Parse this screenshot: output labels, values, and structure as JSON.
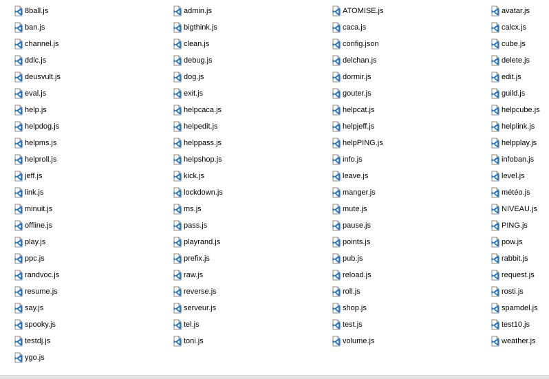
{
  "file_icon": "vscode-js-file-icon",
  "colors": {
    "icon_blue": "#1f74c9",
    "background": "#ffffff",
    "status_strip": "#e4e4e4"
  },
  "columns": [
    [
      "8ball.js",
      "ban.js",
      "channel.js",
      "ddlc.js",
      "deusvult.js",
      "eval.js",
      "help.js",
      "helpdog.js",
      "helpms.js",
      "helproll.js",
      "jeff.js",
      "link.js",
      "minuit.js",
      "offline.js",
      "play.js",
      "ppc.js",
      "randvoc.js",
      "resume.js",
      "say.js",
      "spooky.js",
      "testdj.js",
      "ygo.js"
    ],
    [
      "admin.js",
      "bigthink.js",
      "clean.js",
      "debug.js",
      "dog.js",
      "exit.js",
      "helpcaca.js",
      "helpedit.js",
      "helppass.js",
      "helpshop.js",
      "kick.js",
      "lockdown.js",
      "ms.js",
      "pass.js",
      "playrand.js",
      "prefix.js",
      "raw.js",
      "reverse.js",
      "serveur.js",
      "tel.js",
      "toni.js"
    ],
    [
      "ATOMISE.js",
      "caca.js",
      "config.json",
      "delchan.js",
      "dormir.js",
      "gouter.js",
      "helpcat.js",
      "helpjeff.js",
      "helpPING.js",
      "info.js",
      "leave.js",
      "manger.js",
      "mute.js",
      "pause.js",
      "points.js",
      "pub.js",
      "reload.js",
      "roll.js",
      "shop.js",
      "test.js",
      "volume.js"
    ],
    [
      "avatar.js",
      "calcx.js",
      "cube.js",
      "delete.js",
      "edit.js",
      "guild.js",
      "helpcube.js",
      "helplink.js",
      "helpplay.js",
      "infoban.js",
      "level.js",
      "météo.js",
      "NIVEAU.js",
      "PING.js",
      "pow.js",
      "rabbit.js",
      "request.js",
      "rosti.js",
      "spamdel.js",
      "test10.js",
      "weather.js"
    ]
  ]
}
